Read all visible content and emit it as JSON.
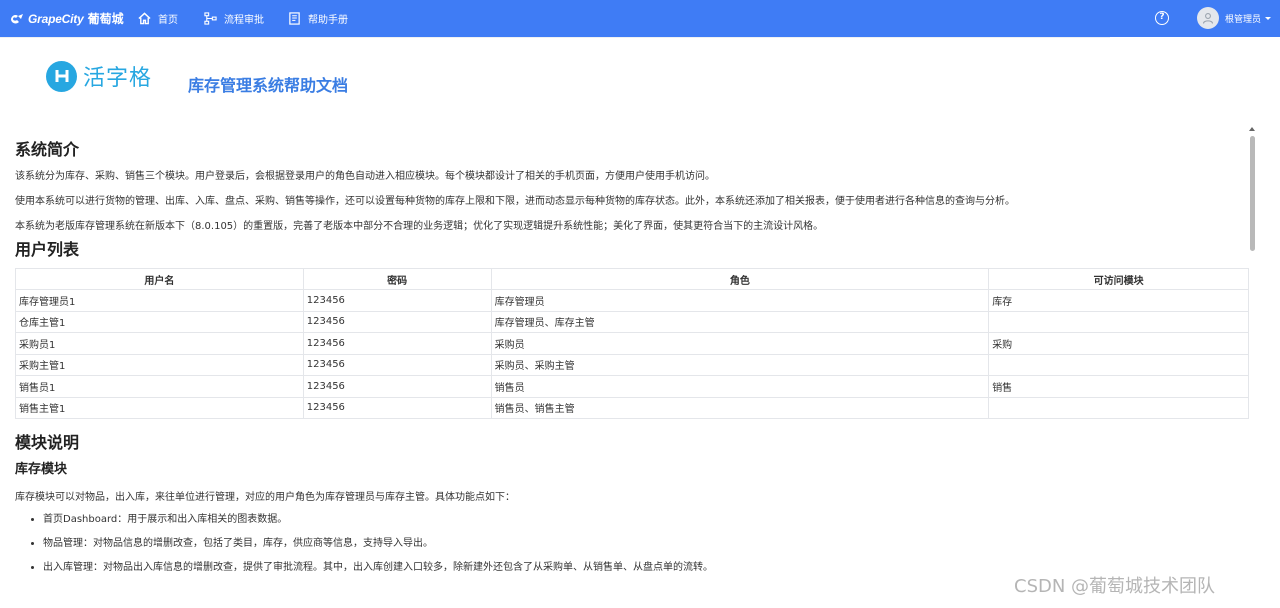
{
  "topbar": {
    "brand_en": "GrapeCity",
    "brand_cn": "葡萄城",
    "nav": [
      {
        "label": "首页",
        "icon": "home-icon"
      },
      {
        "label": "流程审批",
        "icon": "flow-icon"
      },
      {
        "label": "帮助手册",
        "icon": "book-icon"
      }
    ],
    "help_glyph": "?",
    "user_name": "根管理员",
    "color": "#3f7cf5"
  },
  "header": {
    "logo_text": "活字格",
    "doc_title": "库存管理系统帮助文档"
  },
  "intro": {
    "heading": "系统简介",
    "paragraphs": [
      "该系统分为库存、采购、销售三个模块。用户登录后，会根据登录用户的角色自动进入相应模块。每个模块都设计了相关的手机页面，方便用户使用手机访问。",
      "使用本系统可以进行货物的管理、出库、入库、盘点、采购、销售等操作，还可以设置每种货物的库存上限和下限，进而动态显示每种货物的库存状态。此外，本系统还添加了相关报表，便于使用者进行各种信息的查询与分析。",
      "本系统为老版库存管理系统在新版本下（8.0.105）的重置版，完善了老版本中部分不合理的业务逻辑；优化了实现逻辑提升系统性能；美化了界面，使其更符合当下的主流设计风格。"
    ]
  },
  "users": {
    "heading": "用户列表",
    "columns": [
      "用户名",
      "密码",
      "角色",
      "可访问模块"
    ],
    "rows": [
      [
        "库存管理员1",
        "123456",
        "库存管理员",
        "库存"
      ],
      [
        "仓库主管1",
        "123456",
        "库存管理员、库存主管",
        ""
      ],
      [
        "采购员1",
        "123456",
        "采购员",
        "采购"
      ],
      [
        "采购主管1",
        "123456",
        "采购员、采购主管",
        ""
      ],
      [
        "销售员1",
        "123456",
        "销售员",
        "销售"
      ],
      [
        "销售主管1",
        "123456",
        "销售员、销售主管",
        ""
      ]
    ]
  },
  "modules": {
    "heading": "模块说明",
    "inventory": {
      "heading": "库存模块",
      "intro": "库存模块可以对物品，出入库，来往单位进行管理，对应的用户角色为库存管理员与库存主管。具体功能点如下：",
      "items": [
        "首页Dashboard：用于展示和出入库相关的图表数据。",
        "物品管理：对物品信息的增删改查，包括了类目，库存，供应商等信息，支持导入导出。",
        "出入库管理：对物品出入库信息的增删改查，提供了审批流程。其中，出入库创建入口较多，除新建外还包含了从采购单、从销售单、从盘点单的流转。"
      ]
    }
  },
  "watermark": "CSDN @葡萄城技术团队"
}
